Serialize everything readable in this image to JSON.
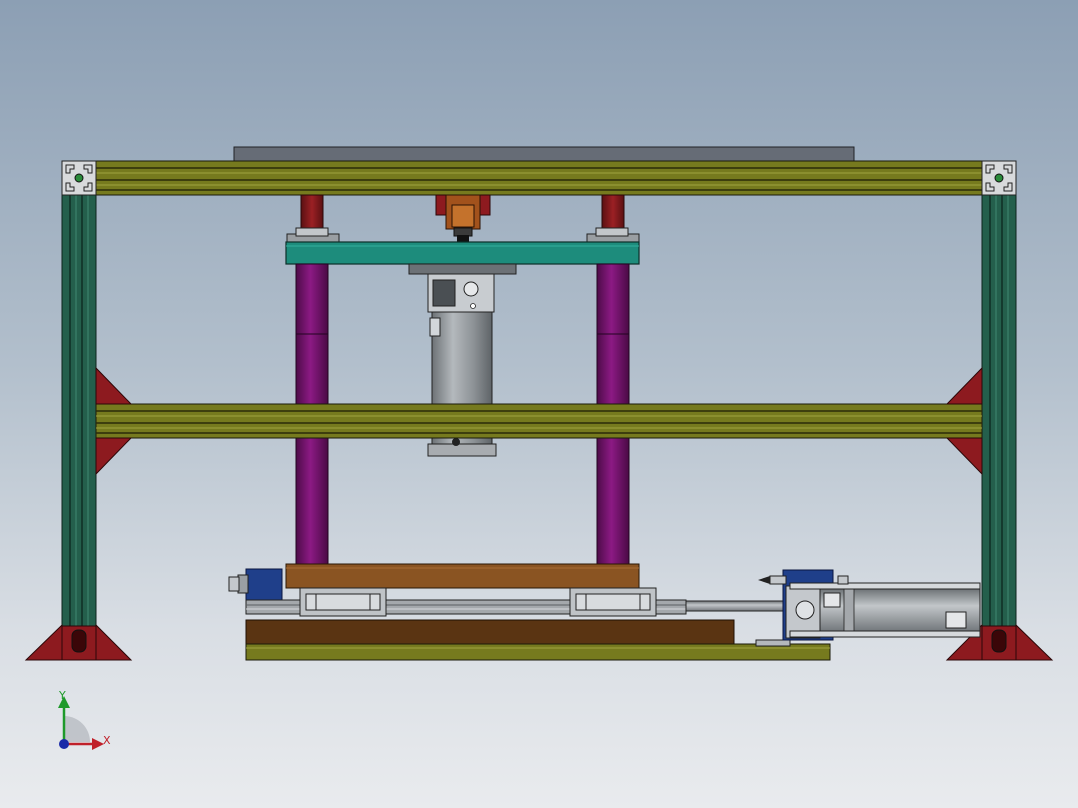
{
  "view": {
    "type": "CAD assembly front view"
  },
  "triad": {
    "x_label": "X",
    "y_label": "Y",
    "x_color": "#c0202a",
    "y_color": "#1e9a2a",
    "z_color": "#1a2aa8"
  },
  "colors": {
    "background_top": "#8c9fb4",
    "background_bottom": "#e9ebee",
    "aluminum_profile": "#7d7d1f",
    "upright_profile": "#245f4c",
    "gusset": "#8d1a1f",
    "guide_column": "#7a1470",
    "moving_plate": "#1d8c7c",
    "base_plate": "#7d5020",
    "cylinder_body": "#8e9396",
    "motor_block": "#1f3f8a"
  }
}
